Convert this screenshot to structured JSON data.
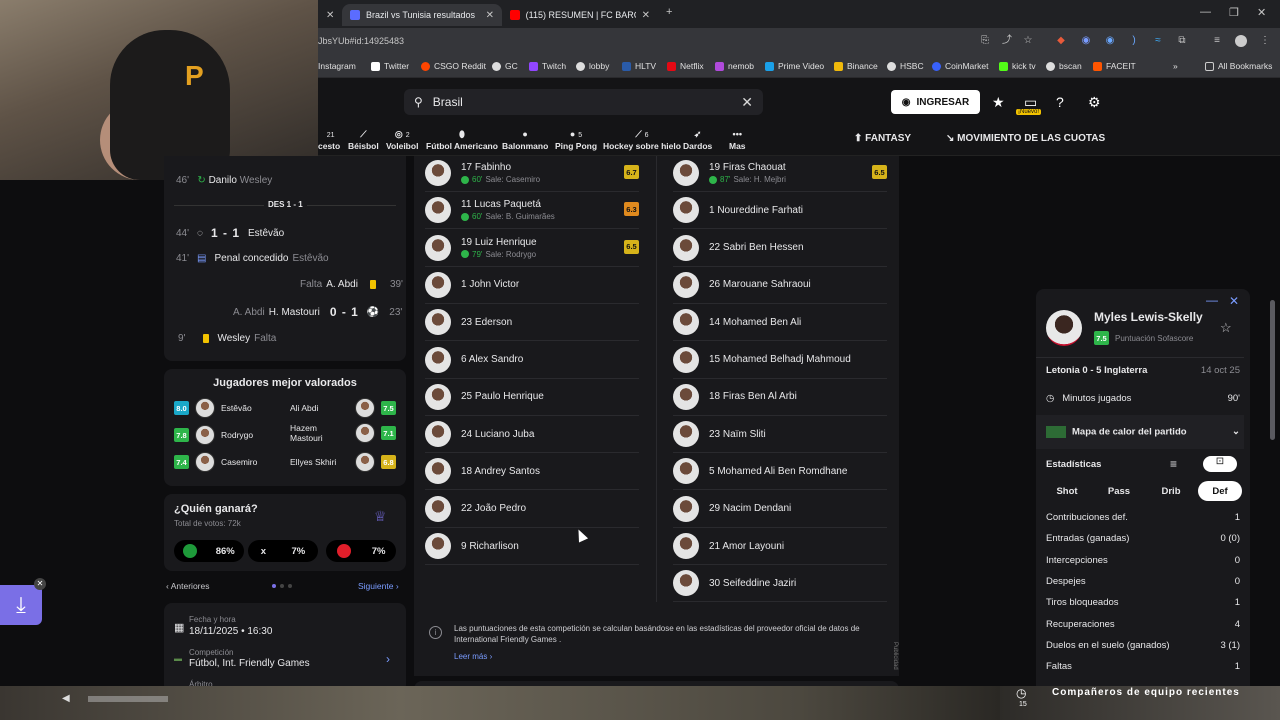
{
  "browser": {
    "tabs": [
      {
        "title": "Brazil vs Tunisia resultados en v"
      },
      {
        "title": "(115) RESUMEN | FC BARCELON"
      }
    ],
    "url": "JbsYUb#id:14925483",
    "bookmarks": [
      "Instagram",
      "Twitter",
      "CSGO Reddit",
      "GC",
      "Twitch",
      "lobby",
      "HLTV",
      "Netflix",
      "nemob",
      "Prime Video",
      "Binance",
      "HSBC",
      "CoinMarket",
      "kick tv",
      "bscan",
      "FACEIT"
    ],
    "all_bookmarks": "All Bookmarks"
  },
  "header": {
    "search_value": "Brasil",
    "login_label": "INGRESAR",
    "new_badge": "¡Nuevo!"
  },
  "sports": [
    {
      "label": "cesto",
      "count": "21"
    },
    {
      "label": "Béisbol",
      "count": ""
    },
    {
      "label": "Voleibol",
      "count": "2"
    },
    {
      "label": "Fútbol Americano",
      "count": ""
    },
    {
      "label": "Balonmano",
      "count": ""
    },
    {
      "label": "Ping Pong",
      "count": "5"
    },
    {
      "label": "Hockey sobre hielo",
      "count": "6"
    },
    {
      "label": "Dardos",
      "count": ""
    },
    {
      "label": "Mas",
      "count": ""
    }
  ],
  "top_links": {
    "fantasy": "FANTASY",
    "odds": "MOVIMIENTO DE LAS CUOTAS"
  },
  "events": {
    "partial": {
      "minute": "46'",
      "text": "Danilo",
      "sub": "Wesley"
    },
    "des_label": "DES 1 - 1",
    "rows": [
      {
        "minute": "44'",
        "score": "1 - 1",
        "name": "Estêvão"
      },
      {
        "minute": "41'",
        "text": "Penal concedido",
        "sub": "Estêvão"
      },
      {
        "minute": "39'",
        "text": "Falta",
        "name": "A. Abdi"
      },
      {
        "minute": "23'",
        "score": "0 - 1",
        "name": "H. Mastouri",
        "assist": "A. Abdi"
      },
      {
        "minute": "9'",
        "name": "Wesley",
        "sub": "Falta"
      }
    ]
  },
  "top_players": {
    "title": "Jugadores mejor valorados",
    "rows": [
      {
        "home": "Estêvão",
        "home_rating": "8.0",
        "away": "Ali Abdi",
        "away_rating": "7.5"
      },
      {
        "home": "Rodrygo",
        "home_rating": "7.8",
        "away": "Hazem Mastouri",
        "away_rating": "7.1"
      },
      {
        "home": "Casemiro",
        "home_rating": "7.4",
        "away": "Ellyes Skhiri",
        "away_rating": "6.8"
      }
    ]
  },
  "vote": {
    "title": "¿Quién ganará?",
    "total": "Total de votos: 72k",
    "home_pct": "86%",
    "draw_label": "x",
    "draw_pct": "7%",
    "away_pct": "7%",
    "prev": "Anteriores",
    "next": "Siguiente"
  },
  "match_info": {
    "date_label": "Fecha y hora",
    "date_value": "18/11/2025  •  16:30",
    "comp_label": "Competición",
    "comp_value": "Fútbol, Int. Friendly Games",
    "ref_label": "Árbitro"
  },
  "lineup": {
    "home": [
      {
        "name": "17 Fabinho",
        "sub_min": "60'",
        "sub": "Sale: Casemiro",
        "rating": "6.7"
      },
      {
        "name": "11 Lucas Paquetá",
        "sub_min": "60'",
        "sub": "Sale: B. Guimarães",
        "rating": "6.3"
      },
      {
        "name": "19 Luiz Henrique",
        "sub_min": "79'",
        "sub": "Sale: Rodrygo",
        "rating": "6.5"
      },
      {
        "name": "1 John Victor"
      },
      {
        "name": "23 Ederson"
      },
      {
        "name": "6 Alex Sandro"
      },
      {
        "name": "25 Paulo Henrique"
      },
      {
        "name": "24 Luciano Juba"
      },
      {
        "name": "18 Andrey Santos"
      },
      {
        "name": "22 João Pedro"
      },
      {
        "name": "9 Richarlison"
      }
    ],
    "away": [
      {
        "name": "19 Firas Chaouat",
        "sub_min": "87'",
        "sub": "Sale: H. Mejbri",
        "rating": "6.5"
      },
      {
        "name": "1 Noureddine Farhati"
      },
      {
        "name": "22 Sabri Ben Hessen"
      },
      {
        "name": "26 Marouane Sahraoui"
      },
      {
        "name": "14 Mohamed Ben Ali"
      },
      {
        "name": "15 Mohamed Belhadj Mahmoud"
      },
      {
        "name": "18 Firas Ben Al Arbi"
      },
      {
        "name": "23 Naïm Sliti"
      },
      {
        "name": "5 Mohamed Ali Ben Romdhane"
      },
      {
        "name": "29 Nacim Dendani"
      },
      {
        "name": "21 Amor Layouni"
      },
      {
        "name": "30 Seifeddine Jaziri"
      }
    ],
    "note": "Las puntuaciones de esta competición se calculan basándose en las estadísticas del proveedor oficial de datos de International Friendly Games .",
    "read_more": "Leer más",
    "ad_label": "Publicidad"
  },
  "player_panel": {
    "name": "Myles Lewis-Skelly",
    "rating": "7.5",
    "rating_label": "Puntuación Sofascore",
    "match": "Letonia 0 - 5 Inglaterra",
    "match_date": "14 oct 25",
    "minutes_label": "Minutos jugados",
    "minutes_value": "90'",
    "heatmap_label": "Mapa de calor del partido",
    "stats_label": "Estadísticas",
    "tabs": [
      "Shot",
      "Pass",
      "Drib",
      "Def"
    ],
    "stats": [
      {
        "label": "Contribuciones def.",
        "value": "1"
      },
      {
        "label": "Entradas (ganadas)",
        "value": "0 (0)"
      },
      {
        "label": "Intercepciones",
        "value": "0"
      },
      {
        "label": "Despejes",
        "value": "0"
      },
      {
        "label": "Tiros bloqueados",
        "value": "1"
      },
      {
        "label": "Recuperaciones",
        "value": "4"
      },
      {
        "label": "Duelos en el suelo (ganados)",
        "value": "3 (1)"
      },
      {
        "label": "Faltas",
        "value": "1"
      }
    ]
  },
  "overlay": {
    "recent_teammates": "Compañeros de equipo recientes",
    "badge_num": "15"
  }
}
